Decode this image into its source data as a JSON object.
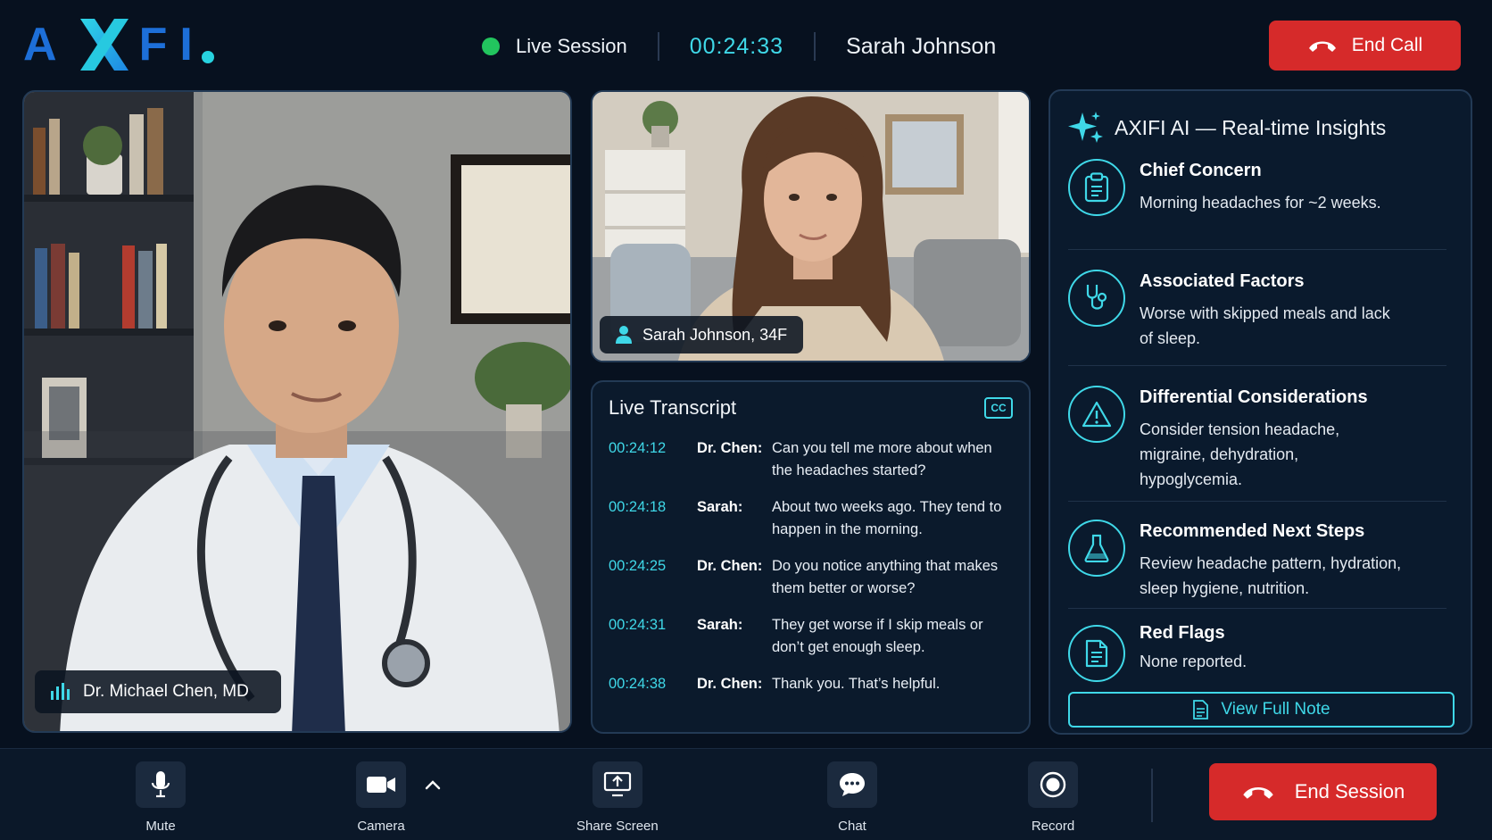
{
  "header": {
    "logo_left": "A",
    "logo_right": "FI",
    "live_label": "Live Session",
    "timer": "00:24:33",
    "patient_name": "Sarah Johnson",
    "end_call_label": "End Call"
  },
  "doctor_video": {
    "name": "Dr. Michael Chen, MD"
  },
  "patient_video": {
    "name": "Sarah Johnson, 34F"
  },
  "transcript": {
    "title": "Live Transcript",
    "cc_label": "CC",
    "entries": [
      {
        "time": "00:24:12",
        "speaker": "Dr. Chen:",
        "text": "Can you tell me more about when the headaches started?"
      },
      {
        "time": "00:24:18",
        "speaker": "Sarah:",
        "text": "About two weeks ago. They tend to happen in the morning."
      },
      {
        "time": "00:24:25",
        "speaker": "Dr. Chen:",
        "text": "Do you notice anything that makes them better or worse?"
      },
      {
        "time": "00:24:31",
        "speaker": "Sarah:",
        "text": "They get worse if I skip meals or don’t get enough sleep."
      },
      {
        "time": "00:24:38",
        "speaker": "Dr. Chen:",
        "text": "Thank you. That’s helpful."
      }
    ]
  },
  "insights": {
    "title": "AXIFI AI — Real-time Insights",
    "items": [
      {
        "icon": "clipboard-icon",
        "heading": "Chief Concern",
        "body": "Morning headaches for ~2 weeks."
      },
      {
        "icon": "stethoscope-icon",
        "heading": "Associated Factors",
        "body": "Worse with skipped meals and lack of sleep."
      },
      {
        "icon": "warning-icon",
        "heading": "Differential Considerations",
        "body": "Consider tension headache, migraine, dehydration, hypoglycemia."
      },
      {
        "icon": "flask-icon",
        "heading": "Recommended Next Steps",
        "body": "Review headache pattern, hydration, sleep hygiene, nutrition."
      },
      {
        "icon": "document-icon",
        "heading": "Red Flags",
        "body": "None reported."
      }
    ],
    "view_note_label": "View Full Note"
  },
  "toolbar": {
    "mute_label": "Mute",
    "camera_label": "Camera",
    "share_label": "Share Screen",
    "chat_label": "Chat",
    "record_label": "Record",
    "end_session_label": "End Session"
  },
  "colors": {
    "accent": "#3fd8e8",
    "danger": "#d62a2a",
    "live": "#22c55e",
    "background": "#07111f",
    "brand_blue": "#1d6fd8"
  }
}
